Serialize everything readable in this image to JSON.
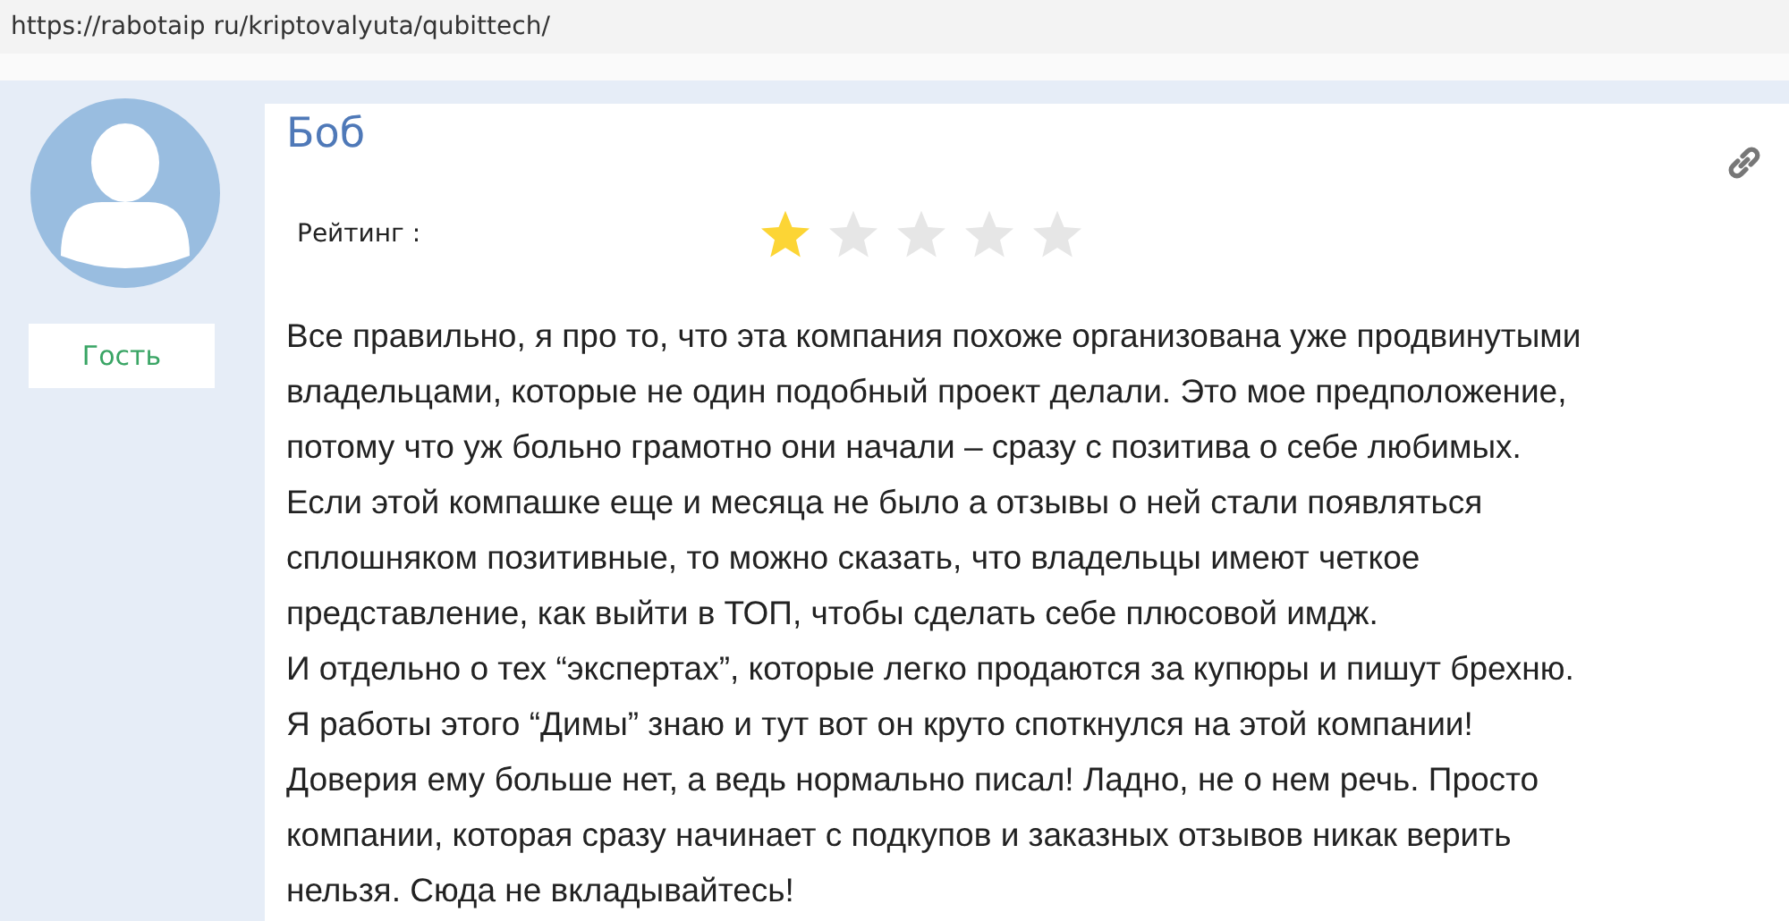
{
  "address_bar": {
    "url": "https://rabotaip ru/kriptovalyuta/qubittech/"
  },
  "review": {
    "author": "Боб",
    "role": "Гость",
    "rating_label": "Рейтинг :",
    "stars": 1,
    "lines": [
      "Все правильно, я про то, что эта компания похоже организована уже продвинутыми",
      "владельцами, которые не один подобный проект делали. Это мое предположение,",
      "потому что уж больно грамотно они начали – сразу с позитива о себе любимых.",
      "Если этой компашке еще и месяца не было а отзывы о ней стали появляться",
      "сплошняком позитивные, то можно сказать, что владельцы имеют четкое",
      "представление, как выйти в ТОП, чтобы сделать себе плюсовой имдж.",
      "И отдельно о тех “экспертах”, которые легко продаются за купюры и пишут брехню.",
      "Я работы этого “Димы” знаю и тут вот он круто споткнулся на этой компании!",
      "Доверия ему больше нет, а ведь нормально писал! Ладно, не о нем речь. Просто",
      "компании, которая сразу начинает с подкупов и заказных отзывов никак верить",
      "нельзя. Сюда не вкладывайтесь!"
    ]
  }
}
